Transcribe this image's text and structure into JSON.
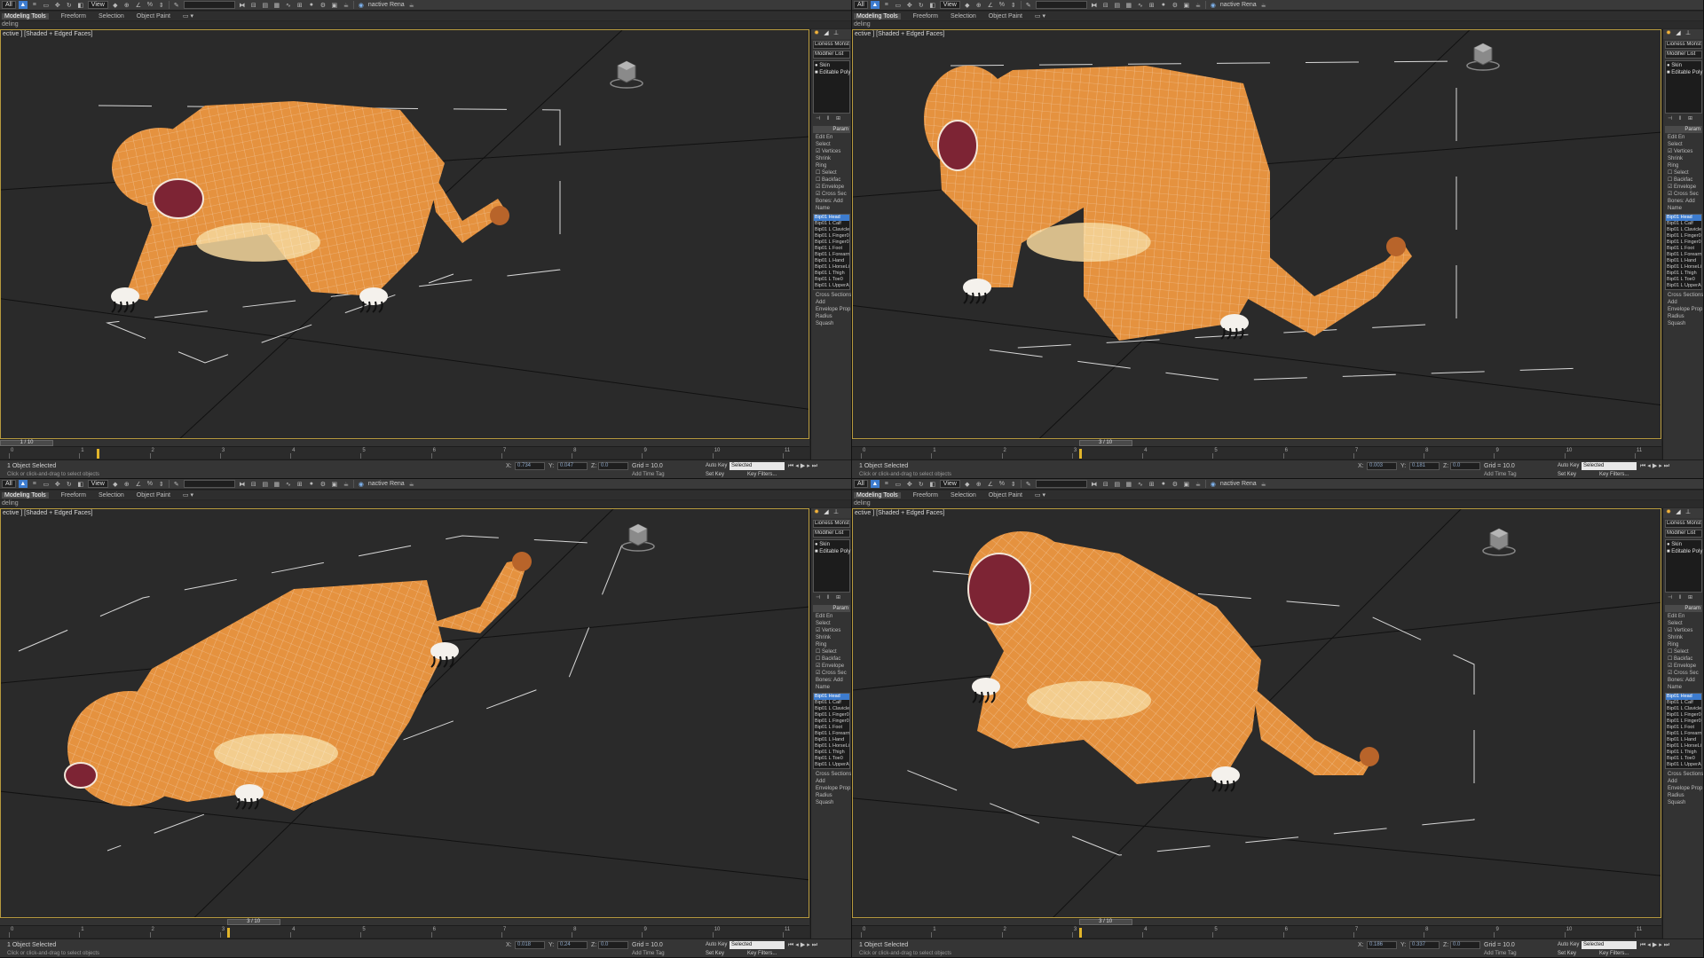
{
  "ui": {
    "toolbar": {
      "filter": "All",
      "ref_coord": "View",
      "selection_set": "",
      "render_label": "nactive Rena"
    },
    "ribbon": {
      "tabs": [
        "Modeling Tools",
        "Freeform",
        "Selection",
        "Object Paint"
      ],
      "sub": "deling"
    },
    "viewport_label": "ective ] [Shaded + Edged Faces]",
    "command_panel": {
      "object_name": "Lioness Monster",
      "modifier_list": "Modifier List",
      "stack": [
        "Skin",
        "Editable Poly"
      ],
      "parameters": "Param",
      "edit_envelopes": "Edit En",
      "select_label": "Select",
      "options": [
        "Vertices",
        "Shrink",
        "Ring",
        "Select",
        "Backfac",
        "Envelope",
        "Cross Sec"
      ],
      "bones_label": "Bones:",
      "add_label": "Add",
      "name_label": "Name",
      "bones": [
        "Bip01 Head",
        "Bip01 L Calf",
        "Bip01 L Clavicle",
        "Bip01 L Finger0",
        "Bip01 L Finger0",
        "Bip01 L Foot",
        "Bip01 L Forearm",
        "Bip01 L Hand",
        "Bip01 L HorseLi",
        "Bip01 L Thigh",
        "Bip01 L Toe0",
        "Bip01 L UpperA"
      ],
      "cross_sections": "Cross Sections",
      "cross_add": "Add",
      "envelope_props": "Envelope Prop",
      "radius": "Radius",
      "squash": "Squash"
    },
    "timeline": {
      "ticks": [
        "0",
        "1",
        "2",
        "3",
        "4",
        "5",
        "6",
        "7",
        "8",
        "9",
        "10",
        "11"
      ]
    },
    "status": {
      "selected": "1 Object Selected",
      "prompt": "Click or click-and-drag to select objects",
      "x_label": "X:",
      "y_label": "Y:",
      "z_label": "Z:",
      "z_value": "0.0",
      "grid": "Grid = 10.0",
      "add_time_tag": "Add Time Tag",
      "auto_key": "Auto Key",
      "set_key": "Set Key",
      "selected_dropdown": "Selected",
      "key_filters": "Key Filters..."
    }
  },
  "quadrants": [
    {
      "frame": "1 / 10",
      "frame_index": 1,
      "x": "0.734",
      "y": "0.047",
      "slider_at": 0
    },
    {
      "frame": "3 / 10",
      "frame_index": 3,
      "x": "0.003",
      "y": "0.181",
      "slider_at": 3
    },
    {
      "frame": "3 / 10",
      "frame_index": 3,
      "x": "0.018",
      "y": "0.24",
      "slider_at": 3
    },
    {
      "frame": "3 / 10",
      "frame_index": 3,
      "x": "0.186",
      "y": "0.337",
      "slider_at": 3
    }
  ],
  "colors": {
    "fur": "#e5923f",
    "fur_light": "#f6d79c",
    "fur_dark": "#b8642a",
    "mouth": "#7d2434",
    "selection": "#3d7ccf",
    "viewport_border": "#b79a3e"
  }
}
